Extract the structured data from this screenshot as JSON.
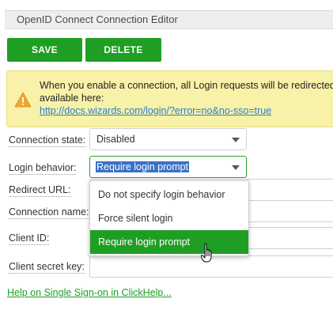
{
  "header": {
    "title": "OpenID Connect Connection Editor"
  },
  "toolbar": {
    "save_label": "SAVE",
    "delete_label": "DELETE"
  },
  "alert": {
    "icon": "warning-icon",
    "line1": "When you enable a connection, all Login requests will be redirected to",
    "line2": "available here:",
    "link": "http://docs.wizards.com/login/?error=no&no-sso=true"
  },
  "form": {
    "connection_state": {
      "label": "Connection state:",
      "value": "Disabled"
    },
    "login_behavior": {
      "label": "Login behavior:",
      "value": "Require login prompt",
      "options": [
        "Do not specify login behavior",
        "Force silent login",
        "Require login prompt"
      ]
    },
    "redirect_url": {
      "label": "Redirect URL:",
      "value": ""
    },
    "connection_name": {
      "label": "Connection name:",
      "value": ""
    },
    "client_id": {
      "label": "Client ID:",
      "value": ""
    },
    "client_secret_key": {
      "label": "Client secret key:",
      "value": ""
    }
  },
  "help_link": "Help on Single Sign-on in ClickHelp...",
  "colors": {
    "accent_green": "#1f9e24",
    "alert_bg": "#f8f1a8",
    "link_blue": "#2a7fc9",
    "selection_blue": "#3a71c7"
  }
}
